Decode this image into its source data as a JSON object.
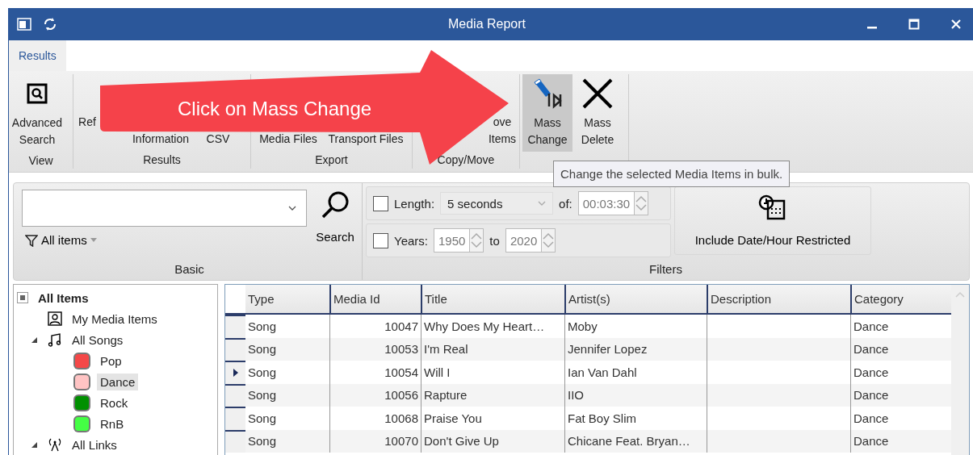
{
  "window": {
    "title": "Media Report"
  },
  "ribbon_tabs": [
    {
      "label": "Results",
      "selected": true
    }
  ],
  "ribbon_groups": [
    {
      "label": "View",
      "buttons": [
        {
          "lines": [
            "Advanced",
            "Search"
          ]
        }
      ]
    },
    {
      "label": "Results",
      "buttons": [
        {
          "lines": [
            "Ref"
          ]
        },
        {
          "lines": [
            "Information"
          ]
        },
        {
          "lines": [
            "CSV"
          ]
        }
      ]
    },
    {
      "label": "Export",
      "buttons": [
        {
          "lines": [
            "Media Files"
          ]
        },
        {
          "lines": [
            "Transport Files"
          ]
        }
      ]
    },
    {
      "label": "Copy/Move",
      "buttons": [
        {
          "lines": [
            "ove",
            "Items"
          ]
        }
      ]
    },
    {
      "buttons": [
        {
          "lines": [
            "Mass",
            "Change"
          ],
          "highlighted": true
        },
        {
          "lines": [
            "Mass",
            "Delete"
          ],
          "highlighted": false
        }
      ]
    }
  ],
  "callout": {
    "text": "Click on Mass Change"
  },
  "tooltip": {
    "text": "Change the selected Media Items in bulk."
  },
  "basic": {
    "label": "Basic",
    "filter": "All items",
    "search_button": "Search"
  },
  "filters": {
    "label": "Filters",
    "length": {
      "label": "Length:",
      "checked": false,
      "value": "5 seconds",
      "of_label": "of:",
      "time": "00:03:30"
    },
    "years": {
      "label": "Years:",
      "checked": false,
      "from": "1950",
      "to_label": "to",
      "to": "2020"
    },
    "restricted_button": "Include Date/Hour Restricted"
  },
  "tree": [
    {
      "label": "All Items",
      "expanded": true,
      "selected": false,
      "children": [
        {
          "label": "My Media Items",
          "selected": false
        },
        {
          "label": "All Songs",
          "expanded": true,
          "selected": false,
          "children": [
            {
              "label": "Pop",
              "color": "#f44848",
              "selected": false
            },
            {
              "label": "Dance",
              "color": "#ffc4c4",
              "selected": true
            },
            {
              "label": "Rock",
              "color": "#009000",
              "selected": false
            },
            {
              "label": "RnB",
              "color": "#44ff44",
              "selected": false
            }
          ]
        },
        {
          "label": "All Links",
          "expanded": true,
          "selected": false
        }
      ]
    }
  ],
  "table": {
    "columns": [
      "Type",
      "Media Id",
      "Title",
      "Artist(s)",
      "Description",
      "Category"
    ],
    "rows": [
      {
        "cells": [
          "Song",
          "10047",
          "Why Does My Heart…",
          "Moby",
          "",
          "Dance"
        ],
        "current": false
      },
      {
        "cells": [
          "Song",
          "10053",
          "I'm Real",
          "Jennifer Lopez",
          "",
          "Dance"
        ],
        "current": false
      },
      {
        "cells": [
          "Song",
          "10054",
          "Will I",
          "Ian Van Dahl",
          "",
          "Dance"
        ],
        "current": true
      },
      {
        "cells": [
          "Song",
          "10056",
          "Rapture",
          "IIO",
          "",
          "Dance"
        ],
        "current": false
      },
      {
        "cells": [
          "Song",
          "10068",
          "Praise You",
          "Fat Boy Slim",
          "",
          "Dance"
        ],
        "current": false
      },
      {
        "cells": [
          "Song",
          "10070",
          "Don't Give Up",
          "Chicane Feat. Bryan…",
          "",
          "Dance"
        ],
        "current": false
      }
    ]
  }
}
